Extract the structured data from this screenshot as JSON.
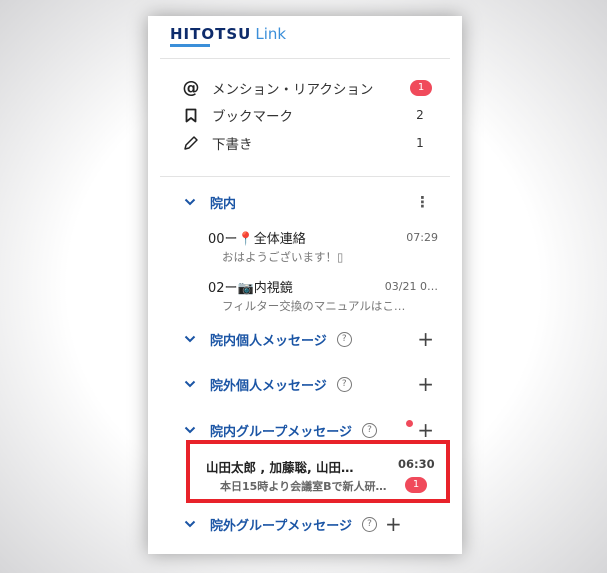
{
  "logo": {
    "brand": "HITOTSU",
    "sub": "Link"
  },
  "menu": [
    {
      "label": "メンション・リアクション",
      "badge": "1"
    },
    {
      "label": "ブックマーク",
      "count": "2"
    },
    {
      "label": "下書き",
      "count": "1"
    }
  ],
  "sections": {
    "innai": {
      "label": "院内"
    },
    "innai_personal": {
      "label": "院内個人メッセージ"
    },
    "ingai_personal": {
      "label": "院外個人メッセージ"
    },
    "innai_group": {
      "label": "院内グループメッセージ"
    },
    "ingai_group": {
      "label": "院外グループメッセージ"
    }
  },
  "help_glyph": "?",
  "threads": [
    {
      "name": "00ー📍全体連絡",
      "time": "07:29",
      "preview": "おはようございます！▯"
    },
    {
      "name": "02ー📷内視鏡",
      "time": "03/21 0…",
      "preview": "フィルター交換のマニュアルはこ…"
    }
  ],
  "group_thread": {
    "name": "山田太郎 , 加藤聡, 山田…",
    "time": "06:30",
    "preview": "本日15時より会議室Bで新人研…",
    "badge": "1"
  },
  "colors": {
    "accent": "#1b55a5",
    "badge": "#f04a5b",
    "highlight": "#e8222a"
  }
}
